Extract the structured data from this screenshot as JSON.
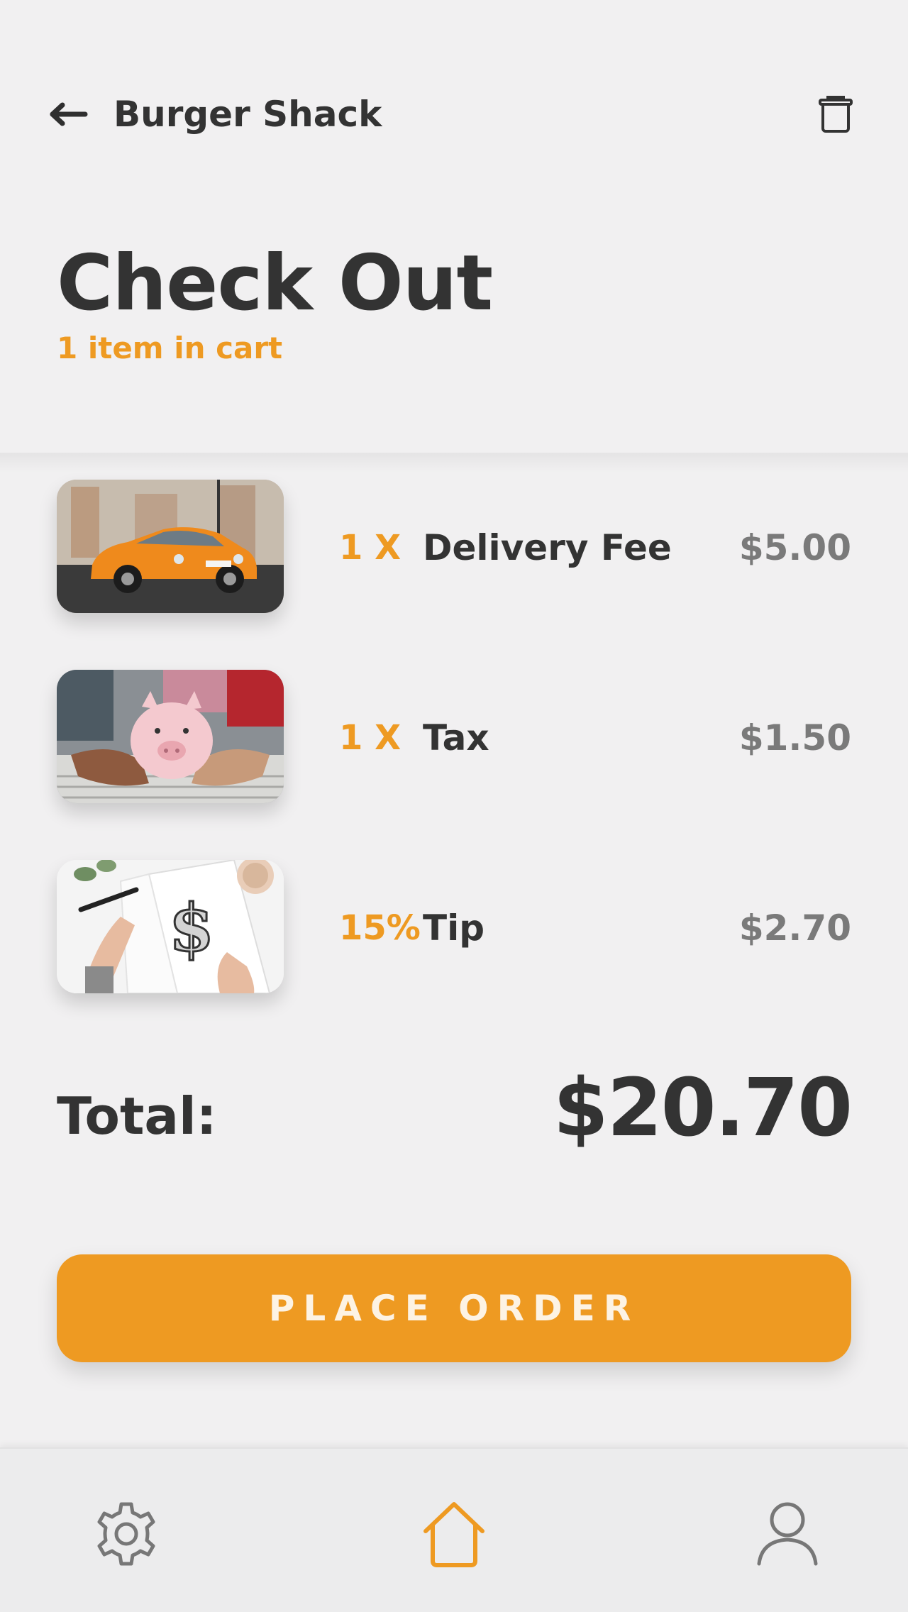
{
  "header": {
    "restaurant": "Burger Shack",
    "back_icon": "arrow-left-icon",
    "trash_icon": "trash-icon"
  },
  "page": {
    "title": "Check Out",
    "cart_count": "1 item in cart"
  },
  "items": [
    {
      "qty": "1 X",
      "name": "Delivery Fee",
      "price": "$5.00",
      "image": "orange sports car photo"
    },
    {
      "qty": "1 X",
      "name": "Tax",
      "price": "$1.50",
      "image": "piggy bank photo"
    },
    {
      "qty": "15%",
      "name": "Tip",
      "price": "$2.70",
      "image": "dollar sign drawing photo"
    }
  ],
  "total": {
    "label": "Total:",
    "value": "$20.70"
  },
  "actions": {
    "place_order": "PLACE ORDER"
  },
  "nav": {
    "settings_icon": "gear-icon",
    "home_icon": "home-icon",
    "profile_icon": "user-icon",
    "active": "home"
  },
  "colors": {
    "accent": "#ee9a22",
    "background": "#f1f0f1",
    "text": "#333333",
    "muted": "#7a7a7a"
  }
}
